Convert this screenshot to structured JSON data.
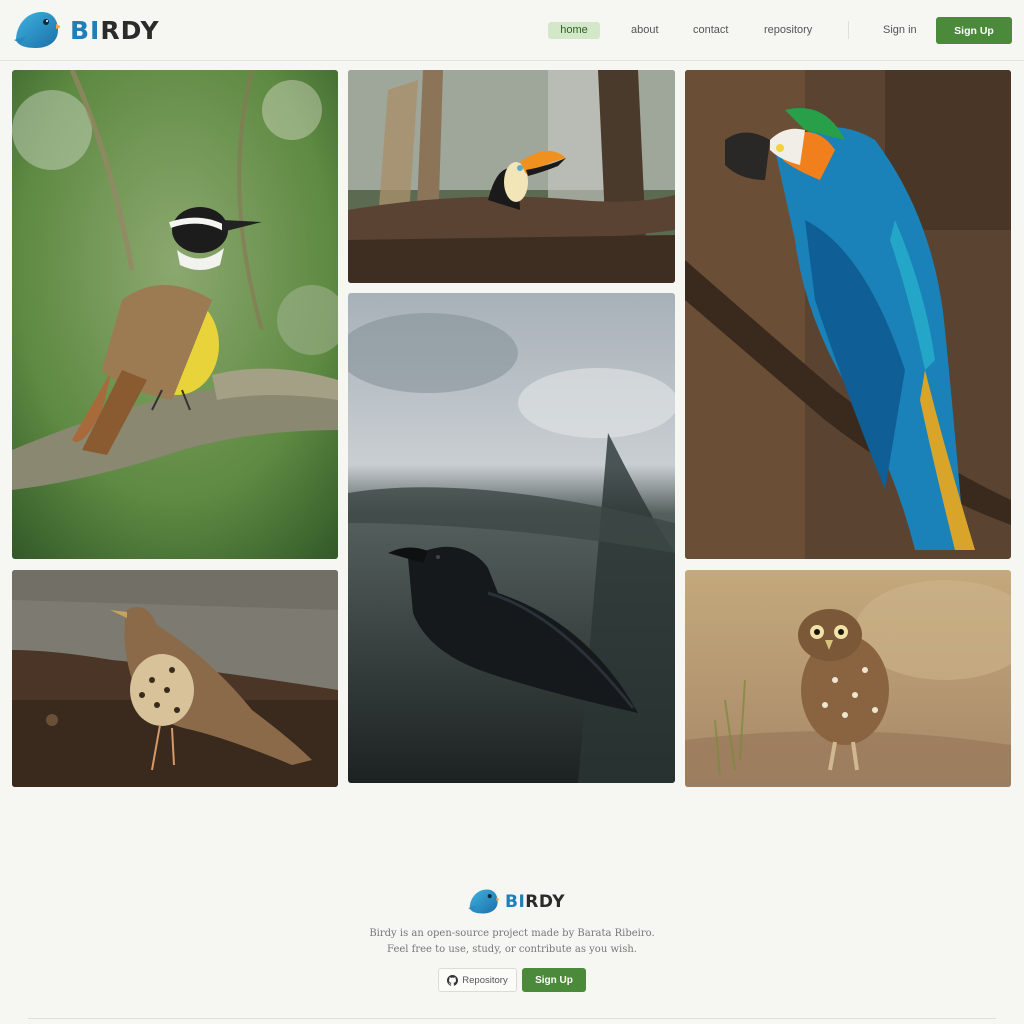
{
  "brand": {
    "name_accent": "BI",
    "name_rest": "RDY",
    "accent_color": "#1f7fb8",
    "primary_color": "#4a8a3a"
  },
  "nav": {
    "items": [
      {
        "label": "home",
        "active": true
      },
      {
        "label": "about",
        "active": false
      },
      {
        "label": "contact",
        "active": false
      },
      {
        "label": "repository",
        "active": false
      }
    ],
    "signin": "Sign in",
    "signup": "Sign Up"
  },
  "gallery": [
    {
      "subject": "kiskadee on branch"
    },
    {
      "subject": "toucan on branch"
    },
    {
      "subject": "macaw on branch"
    },
    {
      "subject": "raven on dark background"
    },
    {
      "subject": "thrush on ground"
    },
    {
      "subject": "burrowing owl in grass"
    }
  ],
  "footer": {
    "line1": "Birdy is an open-source project made by Barata Ribeiro.",
    "line2": "Feel free to use, study, or contribute as you wish.",
    "repo_button": "Repository",
    "signup_button": "Sign Up"
  }
}
